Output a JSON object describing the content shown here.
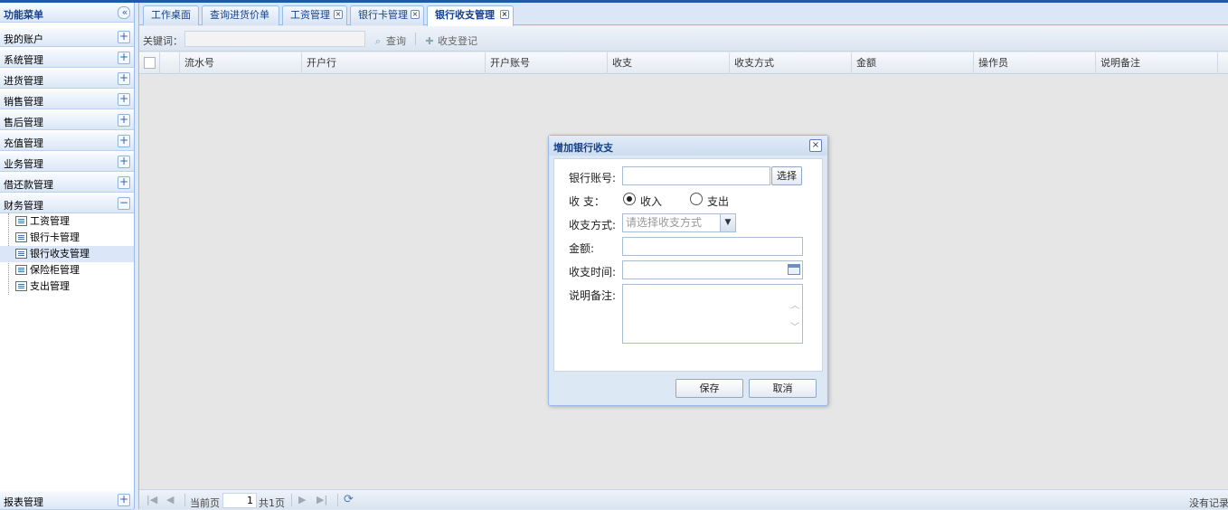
{
  "sidebar": {
    "title": "功能菜单",
    "collapse_icon": "«",
    "sections": [
      {
        "label": "我的账户",
        "state": "+"
      },
      {
        "label": "系统管理",
        "state": "+"
      },
      {
        "label": "进货管理",
        "state": "+"
      },
      {
        "label": "销售管理",
        "state": "+"
      },
      {
        "label": "售后管理",
        "state": "+"
      },
      {
        "label": "充值管理",
        "state": "+"
      },
      {
        "label": "业务管理",
        "state": "+"
      },
      {
        "label": "借还款管理",
        "state": "+"
      },
      {
        "label": "财务管理",
        "state": "−"
      }
    ],
    "tree_items": [
      "工资管理",
      "银行卡管理",
      "银行收支管理",
      "保险柜管理",
      "支出管理"
    ],
    "bottom_section": {
      "label": "报表管理",
      "state": "+"
    }
  },
  "tabs": [
    {
      "label": "工作桌面",
      "closable": false
    },
    {
      "label": "查询进货价单",
      "closable": false
    },
    {
      "label": "工资管理",
      "closable": true
    },
    {
      "label": "银行卡管理",
      "closable": true
    },
    {
      "label": "银行收支管理",
      "closable": true,
      "active": true
    }
  ],
  "tab_close_glyph": "×",
  "toolbar": {
    "keyword_label": "关键词：",
    "keyword_value": "",
    "search_label": "查询",
    "add_label": "收支登记"
  },
  "grid": {
    "columns": [
      "流水号",
      "开户行",
      "开户账号",
      "收支",
      "收支方式",
      "金额",
      "操作员",
      "说明备注"
    ]
  },
  "pager": {
    "current_label": "当前页",
    "page_value": "1",
    "total_label": "共1页",
    "info": "没有记录"
  },
  "dialog": {
    "title": "增加银行收支",
    "close_glyph": "×",
    "fields": {
      "account_label": "银行账号:",
      "select_button": "选择",
      "type_label": "收 支：",
      "income_label": "收入",
      "expense_label": "支出",
      "method_label": "收支方式:",
      "method_placeholder": "请选择收支方式",
      "amount_label": "金额:",
      "time_label": "收支时间:",
      "remark_label": "说明备注:"
    },
    "save_button": "保存",
    "cancel_button": "取消"
  },
  "colors": {
    "accent": "#15428b",
    "border": "#99bbe8",
    "panel_bg": "#dfe8f6"
  }
}
